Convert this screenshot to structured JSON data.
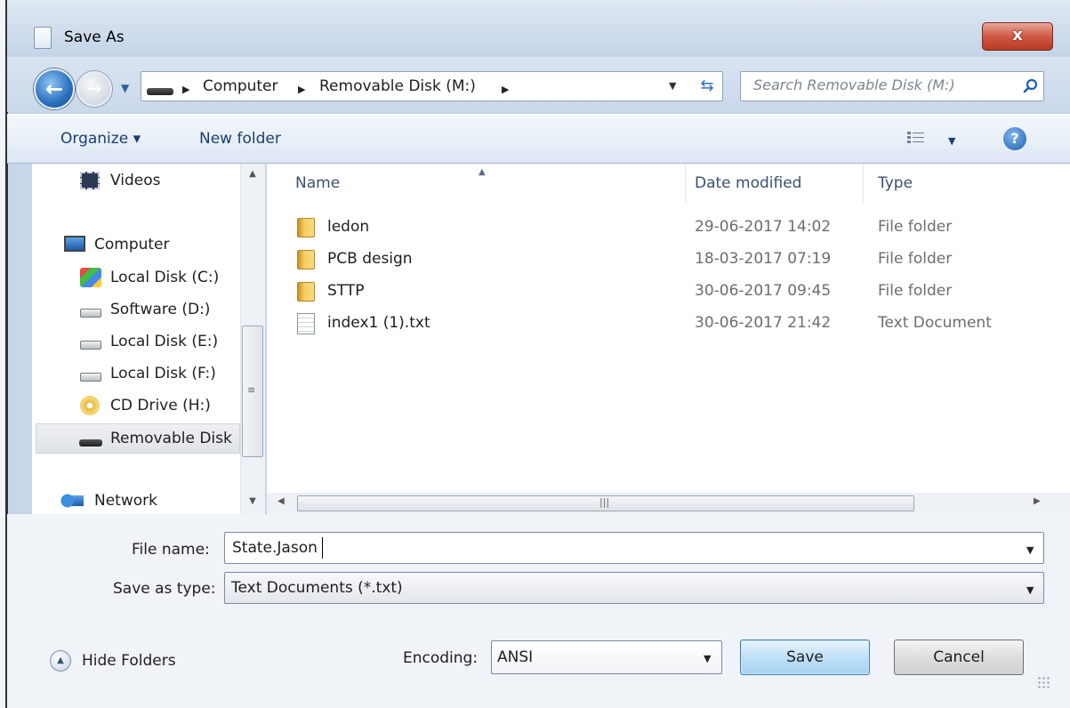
{
  "window": {
    "title": "Save As",
    "close_label": "x"
  },
  "nav": {
    "breadcrumb": [
      "Computer",
      "Removable Disk (M:)"
    ],
    "search_placeholder": "Search Removable Disk (M:)"
  },
  "toolbar": {
    "organize_label": "Organize ▾",
    "new_folder_label": "New folder"
  },
  "sidebar": {
    "items": [
      {
        "label": "Videos",
        "icon": "video-icon"
      },
      {
        "label": "Computer",
        "icon": "computer-icon"
      },
      {
        "label": "Local Disk (C:)",
        "icon": "system-disk-icon"
      },
      {
        "label": "Software (D:)",
        "icon": "hard-drive-icon"
      },
      {
        "label": "Local Disk (E:)",
        "icon": "hard-drive-icon"
      },
      {
        "label": "Local Disk (F:)",
        "icon": "hard-drive-icon"
      },
      {
        "label": "CD Drive (H:)",
        "icon": "cd-drive-icon"
      },
      {
        "label": "Removable Disk",
        "icon": "removable-disk-icon",
        "selected": true
      },
      {
        "label": "Network",
        "icon": "network-icon"
      }
    ]
  },
  "files": {
    "columns": [
      "Name",
      "Date modified",
      "Type"
    ],
    "rows": [
      {
        "name": "ledon",
        "date": "29-06-2017 14:02",
        "type": "File folder",
        "icon": "folder-icon"
      },
      {
        "name": "PCB design",
        "date": "18-03-2017 07:19",
        "type": "File folder",
        "icon": "folder-icon"
      },
      {
        "name": "STTP",
        "date": "30-06-2017 09:45",
        "type": "File folder",
        "icon": "folder-icon"
      },
      {
        "name": "index1 (1).txt",
        "date": "30-06-2017 21:42",
        "type": "Text Document",
        "icon": "text-file-icon"
      }
    ]
  },
  "form": {
    "file_name_label": "File name:",
    "file_name_value": "State.Jason",
    "save_type_label": "Save as type:",
    "save_type_value": "Text Documents (*.txt)",
    "encoding_label": "Encoding:",
    "encoding_value": "ANSI"
  },
  "footer": {
    "hide_folders_label": "Hide Folders",
    "save_label": "Save",
    "cancel_label": "Cancel"
  },
  "colors": {
    "accent": "#1a3f73",
    "selection": "#dfe3e8",
    "save_button": "#bfe0f8"
  }
}
